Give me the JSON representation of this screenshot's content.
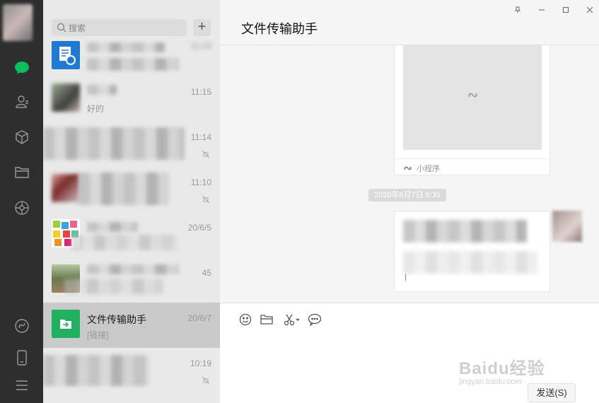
{
  "rail": {
    "icons": [
      "chat-icon",
      "contacts-icon",
      "cube-icon",
      "folder-icon",
      "moments-icon",
      "miniprogram-icon",
      "phone-icon",
      "menu-icon"
    ],
    "accent": "#07c160"
  },
  "search": {
    "placeholder": "搜索",
    "add_label": "+"
  },
  "chats": [
    {
      "name": "",
      "time": "11:15",
      "preview": ""
    },
    {
      "name": "",
      "time": "11:15",
      "preview": "好的"
    },
    {
      "name": "",
      "time": "11:14",
      "preview": ""
    },
    {
      "name": "",
      "time": "11:10",
      "preview": ""
    },
    {
      "name": "",
      "time": "20/6/5",
      "preview": ""
    },
    {
      "name": "",
      "time": "45",
      "preview": ""
    },
    {
      "name": "文件传输助手",
      "time": "20/6/7",
      "preview": "[链接]"
    },
    {
      "name": "",
      "time": "10:19",
      "preview": ""
    }
  ],
  "main": {
    "title": "文件传输助手",
    "window_controls": [
      "pin-icon",
      "minimize-icon",
      "maximize-icon",
      "close-icon"
    ],
    "card_footer": "小程序",
    "date_separator": "2020年6月7日 6:31",
    "send_label": "发送(S)",
    "watermark": "Baidu经验",
    "watermark_url": "jingyan.baidu.com"
  }
}
